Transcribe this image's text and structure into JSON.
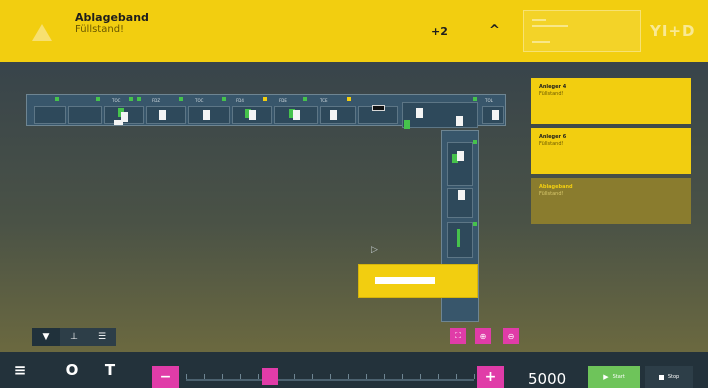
{
  "alert": {
    "title": "Ablageband",
    "subtitle": "Füllstand!",
    "count": "+2",
    "collapse_icon": "chevron-up-icon",
    "warning_icon": "warning-triangle-icon",
    "logo": "YI+D"
  },
  "layout_labels": {
    "top_row": [
      "TOC",
      "FDZ",
      "TOC",
      "FD4",
      "FDE",
      "TCE",
      "TOL"
    ]
  },
  "notifications": [
    {
      "title": "Anleger 4",
      "subtitle": "Füllstand!"
    },
    {
      "title": "Anleger 6",
      "subtitle": "Füllstand!"
    },
    {
      "title": "Ablageband",
      "subtitle": "Füllstand!"
    }
  ],
  "tools": {
    "icons": [
      "conveyor-tool-icon",
      "place-tool-icon",
      "settings-sliders-icon"
    ],
    "zoom": [
      "fit-screen-icon",
      "zoom-in-icon",
      "zoom-out-icon"
    ]
  },
  "bottombar": {
    "menu_icon": "menu-icon",
    "circle_icon": "circle-icon",
    "t_icon": "t-tool-icon",
    "minus": "−",
    "plus": "+",
    "timeline_value": 0.29,
    "speed": "5000",
    "start_label": "Start",
    "stop_label": "Stop"
  },
  "colors": {
    "accent_yellow": "#f2ce10",
    "accent_pink": "#e03ca8",
    "start_green": "#6ec45a"
  }
}
